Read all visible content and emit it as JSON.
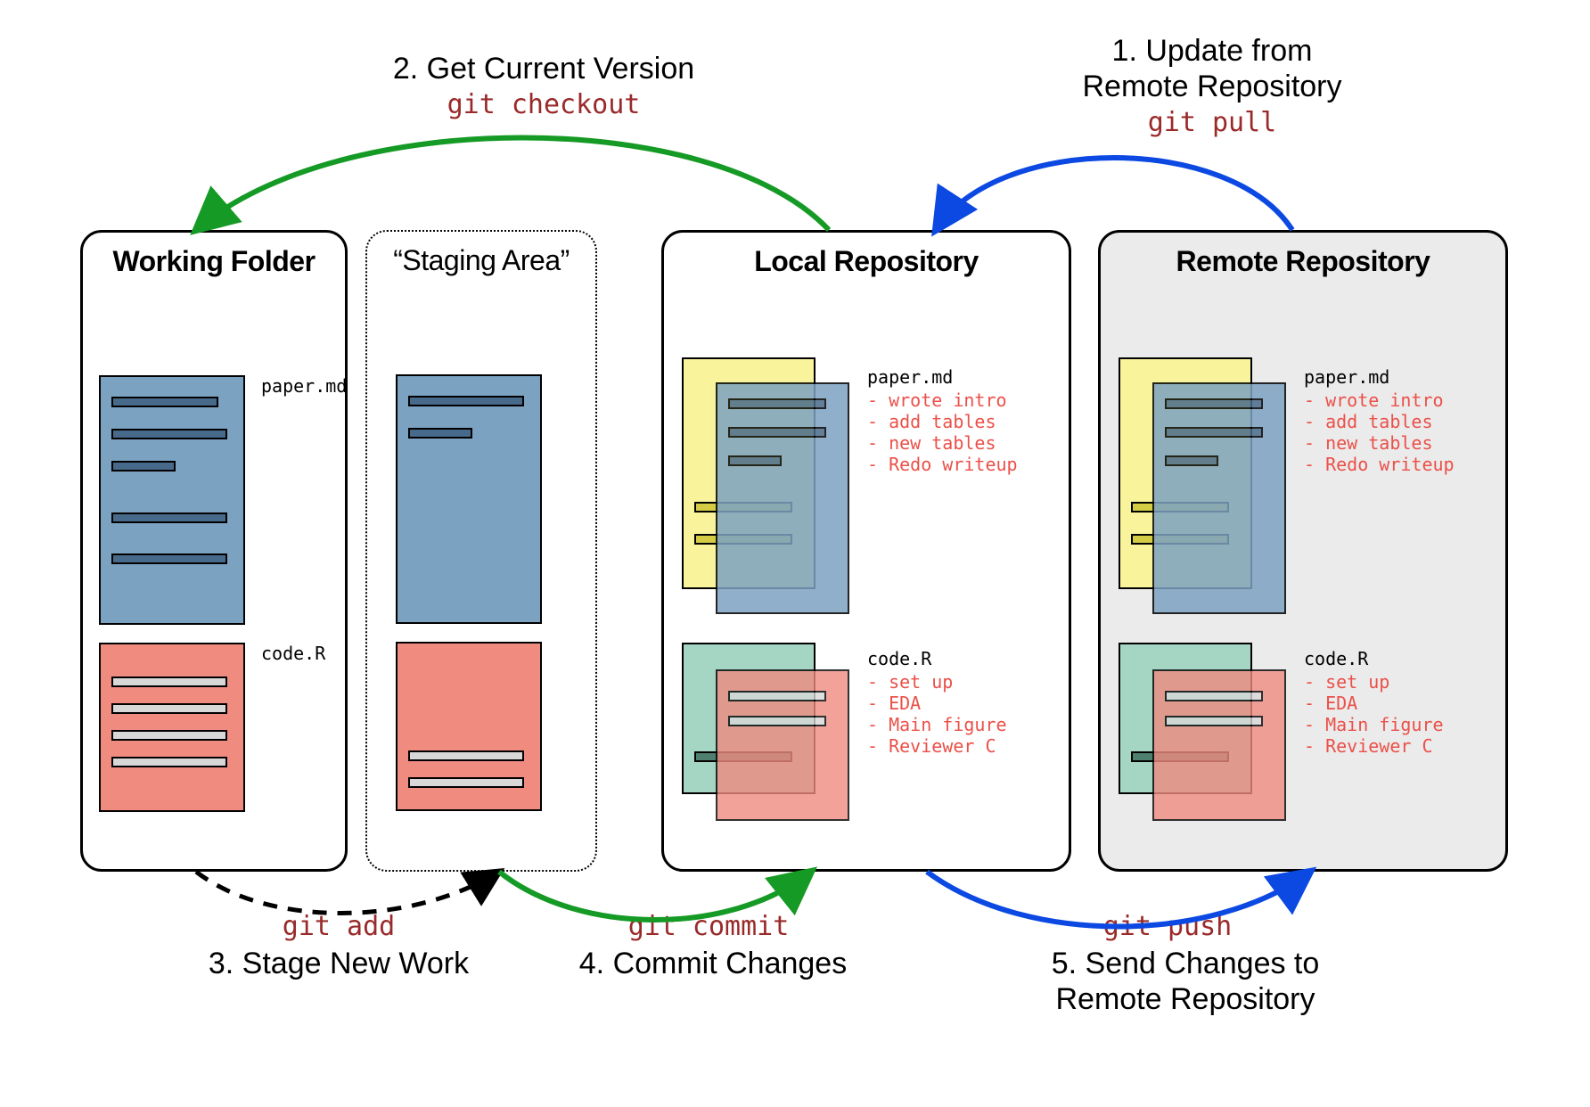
{
  "steps": {
    "s1": "1. Update from",
    "s1b": "Remote Repository",
    "s2": "2. Get Current Version",
    "s3": "3. Stage New Work",
    "s4": "4. Commit Changes",
    "s5a": "5. Send Changes to",
    "s5b": "Remote Repository"
  },
  "cmds": {
    "pull": "git pull",
    "checkout": "git checkout",
    "add": "git add",
    "commit": "git commit",
    "push": "git push"
  },
  "panels": {
    "working": {
      "title": "Working Folder"
    },
    "staging": {
      "title": "“Staging Area”"
    },
    "local": {
      "title": "Local Repository"
    },
    "remote": {
      "title": "Remote Repository"
    }
  },
  "files": {
    "paper": {
      "name": "paper.md",
      "history": [
        "- wrote intro",
        "- add tables",
        "- new tables",
        "- Redo writeup"
      ]
    },
    "code": {
      "name": "code.R",
      "history": [
        "- set up",
        "- EDA",
        "- Main figure",
        "- Reviewer C"
      ]
    }
  }
}
